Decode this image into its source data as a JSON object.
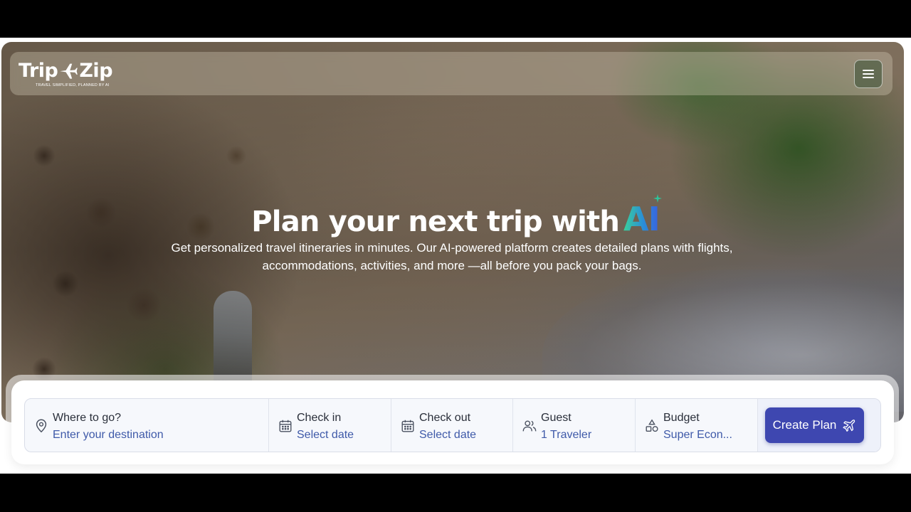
{
  "brand": {
    "name_left": "Trip",
    "name_right": "Zip",
    "tagline": "TRAVEL SIMPLIFIED, PLANNED BY AI",
    "logo_icon": "airplane-icon",
    "color": "#ffffff"
  },
  "nav": {
    "menu_icon": "hamburger-menu-icon"
  },
  "hero": {
    "headline": "Plan your next trip with",
    "headline_accent": "AI",
    "accent_gradient": [
      "#3ad19a",
      "#2a8dd8",
      "#3a5fe0"
    ],
    "subtitle": "Get personalized travel itineraries in minutes. Our AI-powered platform creates detailed plans with flights, accommodations, activities, and more —all before you pack your bags."
  },
  "search": {
    "destination": {
      "label": "Where to go?",
      "placeholder": "Enter your destination",
      "icon": "map-pin-icon"
    },
    "check_in": {
      "label": "Check in",
      "value": "Select date",
      "icon": "calendar-icon"
    },
    "check_out": {
      "label": "Check out",
      "value": "Select date",
      "icon": "calendar-icon"
    },
    "guest": {
      "label": "Guest",
      "value": "1 Traveler",
      "icon": "users-icon"
    },
    "budget": {
      "label": "Budget",
      "value": "Super Econ...",
      "icon": "shapes-icon"
    },
    "submit": {
      "label": "Create Plan",
      "icon": "airplane-icon",
      "color": "#3e47b0"
    },
    "value_color": "#3f5aa9"
  }
}
